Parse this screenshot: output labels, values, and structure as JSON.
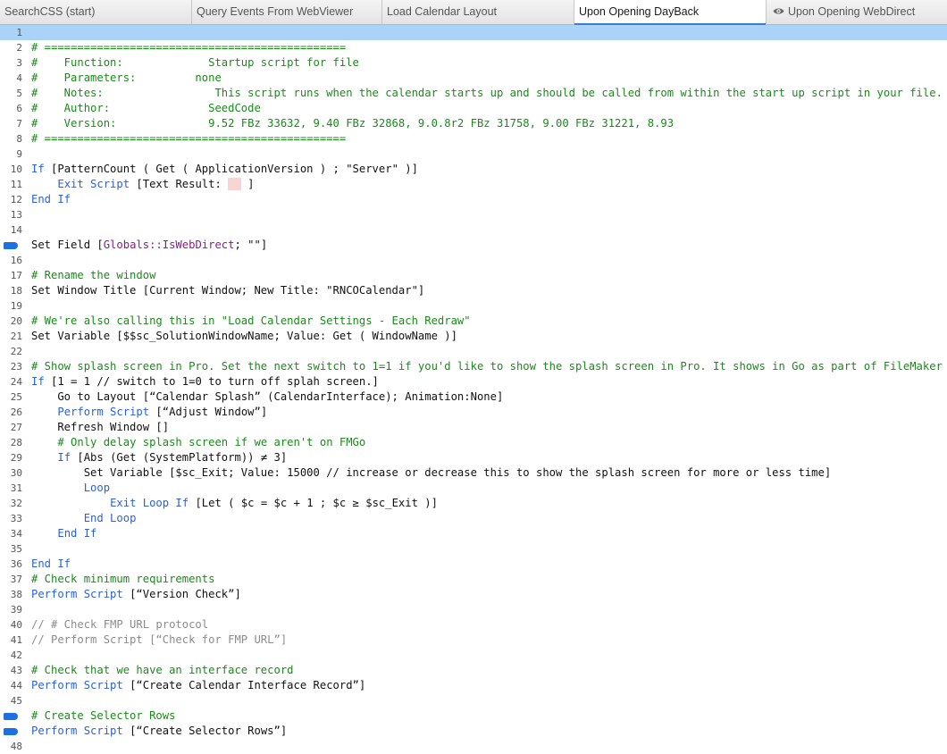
{
  "tabs": [
    {
      "label": "SearchCSS (start)",
      "active": false
    },
    {
      "label": "Query Events From WebViewer",
      "active": false
    },
    {
      "label": "Load Calendar Layout",
      "active": false
    },
    {
      "label": "Upon Opening DayBack",
      "active": true
    },
    {
      "label": "Upon Opening WebDirect",
      "active": false,
      "icon": "eye-icon"
    }
  ],
  "colors": {
    "keyword": "#2a5fdc",
    "comment": "#1a8a1a",
    "disabled": "#8c8c8c",
    "field": "#8b1a8b",
    "highlight": "#abd2f7",
    "breakpoint": "#1e6fe0"
  },
  "lines": [
    {
      "n": "1",
      "hl": true,
      "parts": []
    },
    {
      "n": "2",
      "parts": [
        {
          "t": "# ==============================================",
          "c": "cm"
        }
      ]
    },
    {
      "n": "3",
      "parts": [
        {
          "t": "#    Function:             Startup script for file",
          "c": "cm"
        }
      ]
    },
    {
      "n": "4",
      "parts": [
        {
          "t": "#    Parameters:         none",
          "c": "cm"
        }
      ]
    },
    {
      "n": "5",
      "parts": [
        {
          "t": "#    Notes:                 This script runs when the calendar starts up and should be called from within the start up script in your file.",
          "c": "cm"
        }
      ]
    },
    {
      "n": "6",
      "parts": [
        {
          "t": "#    Author:               SeedCode",
          "c": "cm"
        }
      ]
    },
    {
      "n": "7",
      "parts": [
        {
          "t": "#    Version:              9.52 FBz 33632, 9.40 FBz 32868, 9.0.8r2 FBz 31758, 9.00 FBz 31221, 8.93",
          "c": "cm"
        }
      ]
    },
    {
      "n": "8",
      "parts": [
        {
          "t": "# ==============================================",
          "c": "cm"
        }
      ]
    },
    {
      "n": "9",
      "parts": []
    },
    {
      "n": "10",
      "parts": [
        {
          "t": "If",
          "c": "kw"
        },
        {
          "t": " [PatternCount ( Get ( ApplicationVersion ) ; \"Server\" )]"
        }
      ]
    },
    {
      "n": "11",
      "parts": [
        {
          "t": "    "
        },
        {
          "t": "Exit Script",
          "c": "kw"
        },
        {
          "t": " [Text Result: "
        },
        {
          "t": "  ",
          "c": "pink"
        },
        {
          "t": " ]"
        }
      ]
    },
    {
      "n": "12",
      "parts": [
        {
          "t": "End If",
          "c": "kw"
        }
      ]
    },
    {
      "n": "13",
      "parts": []
    },
    {
      "n": "14",
      "parts": []
    },
    {
      "n": "15",
      "bp": true,
      "parts": [
        {
          "t": "Set Field ["
        },
        {
          "t": "Globals::IsWebDirect",
          "c": "fld"
        },
        {
          "t": "; \"\"]"
        }
      ]
    },
    {
      "n": "16",
      "parts": []
    },
    {
      "n": "17",
      "parts": [
        {
          "t": "# Rename the window",
          "c": "cm"
        }
      ]
    },
    {
      "n": "18",
      "parts": [
        {
          "t": "Set Window Title [Current Window; New Title: \"RNCOCalendar\"]"
        }
      ]
    },
    {
      "n": "19",
      "parts": []
    },
    {
      "n": "20",
      "parts": [
        {
          "t": "# We're also calling this in \"Load Calendar Settings - Each Redraw\"",
          "c": "cm"
        }
      ]
    },
    {
      "n": "21",
      "parts": [
        {
          "t": "Set Variable [$$sc_SolutionWindowName; Value: Get ( WindowName )]"
        }
      ]
    },
    {
      "n": "22",
      "parts": []
    },
    {
      "n": "23",
      "parts": [
        {
          "t": "# Show splash screen in Pro. Set the next switch to 1=1 if you'd like to show the splash screen in Pro. It shows in Go as part of FileMaker Go's…",
          "c": "cm"
        }
      ]
    },
    {
      "n": "24",
      "parts": [
        {
          "t": "If",
          "c": "kw"
        },
        {
          "t": " [1 = 1 // switch to 1=0 to turn off splah screen.]"
        }
      ]
    },
    {
      "n": "25",
      "parts": [
        {
          "t": "    Go to Layout [“Calendar Splash” (CalendarInterface); Animation:None]"
        }
      ]
    },
    {
      "n": "26",
      "parts": [
        {
          "t": "    "
        },
        {
          "t": "Perform Script",
          "c": "kw"
        },
        {
          "t": " [“Adjust Window”]"
        }
      ]
    },
    {
      "n": "27",
      "parts": [
        {
          "t": "    Refresh Window []"
        }
      ]
    },
    {
      "n": "28",
      "parts": [
        {
          "t": "    "
        },
        {
          "t": "# Only delay splash screen if we aren't on FMGo",
          "c": "cm"
        }
      ]
    },
    {
      "n": "29",
      "parts": [
        {
          "t": "    "
        },
        {
          "t": "If",
          "c": "kw"
        },
        {
          "t": " [Abs (Get (SystemPlatform)) ≠ 3]"
        }
      ]
    },
    {
      "n": "30",
      "parts": [
        {
          "t": "        Set Variable [$sc_Exit; Value: 15000 // increase or decrease this to show the splash screen for more or less time]"
        }
      ]
    },
    {
      "n": "31",
      "parts": [
        {
          "t": "        "
        },
        {
          "t": "Loop",
          "c": "kw"
        }
      ]
    },
    {
      "n": "32",
      "parts": [
        {
          "t": "            "
        },
        {
          "t": "Exit Loop If",
          "c": "kw"
        },
        {
          "t": " [Let ( $c = $c + 1 ; $c ≥ $sc_Exit )]"
        }
      ]
    },
    {
      "n": "33",
      "parts": [
        {
          "t": "        "
        },
        {
          "t": "End Loop",
          "c": "kw"
        }
      ]
    },
    {
      "n": "34",
      "parts": [
        {
          "t": "    "
        },
        {
          "t": "End If",
          "c": "kw"
        }
      ]
    },
    {
      "n": "35",
      "parts": []
    },
    {
      "n": "36",
      "parts": [
        {
          "t": "End If",
          "c": "kw"
        }
      ]
    },
    {
      "n": "37",
      "parts": [
        {
          "t": "# Check minimum requirements",
          "c": "cm"
        }
      ]
    },
    {
      "n": "38",
      "parts": [
        {
          "t": "Perform Script",
          "c": "kw"
        },
        {
          "t": " [“Version Check”]"
        }
      ]
    },
    {
      "n": "39",
      "parts": []
    },
    {
      "n": "40",
      "parts": [
        {
          "t": "// # Check FMP URL protocol",
          "c": "dis"
        }
      ]
    },
    {
      "n": "41",
      "parts": [
        {
          "t": "// Perform Script [“Check for FMP URL”]",
          "c": "dis"
        }
      ]
    },
    {
      "n": "42",
      "parts": []
    },
    {
      "n": "43",
      "parts": [
        {
          "t": "# Check that we have an interface record",
          "c": "cm"
        }
      ]
    },
    {
      "n": "44",
      "parts": [
        {
          "t": "Perform Script",
          "c": "kw"
        },
        {
          "t": " [“Create Calendar Interface Record”]"
        }
      ]
    },
    {
      "n": "45",
      "parts": []
    },
    {
      "n": "46",
      "bp": true,
      "parts": [
        {
          "t": "# Create Selector Rows",
          "c": "cm"
        }
      ]
    },
    {
      "n": "47",
      "bp": true,
      "parts": [
        {
          "t": "Perform Script",
          "c": "kw"
        },
        {
          "t": " [“Create Selector Rows”]"
        }
      ]
    },
    {
      "n": "48",
      "parts": []
    }
  ]
}
